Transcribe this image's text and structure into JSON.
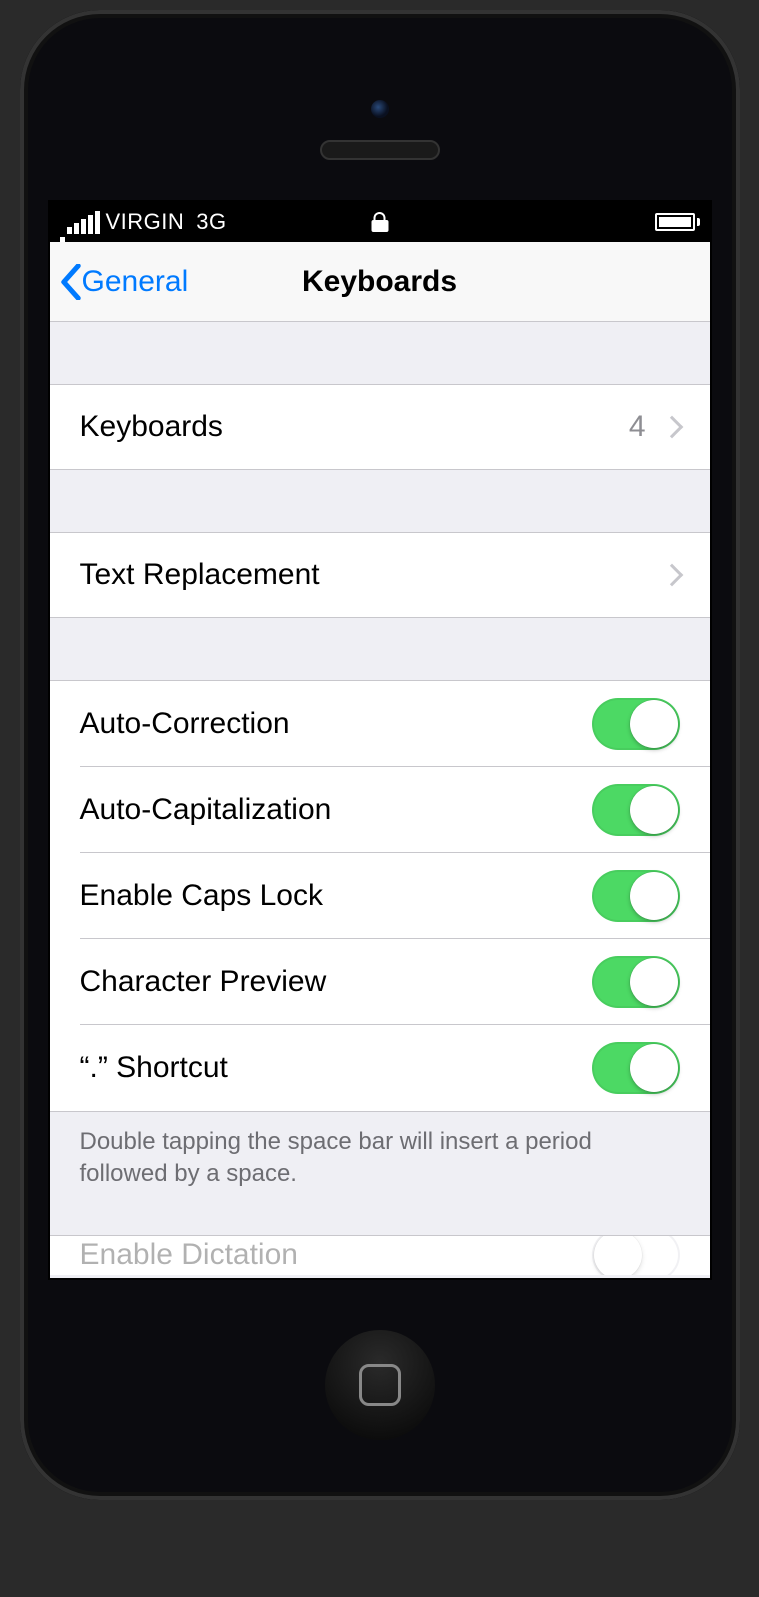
{
  "statusbar": {
    "carrier": "VIRGIN",
    "network": "3G"
  },
  "nav": {
    "back_label": "General",
    "title": "Keyboards"
  },
  "rows": {
    "keyboards": {
      "label": "Keyboards",
      "value": "4"
    },
    "text_replacement": {
      "label": "Text Replacement"
    }
  },
  "toggles": [
    {
      "label": "Auto-Correction",
      "on": true
    },
    {
      "label": "Auto-Capitalization",
      "on": true
    },
    {
      "label": "Enable Caps Lock",
      "on": true
    },
    {
      "label": "Character Preview",
      "on": true
    },
    {
      "label": "“.” Shortcut",
      "on": true
    }
  ],
  "footer": "Double tapping the space bar will insert a period followed by a space.",
  "peek": {
    "label": "Enable Dictation",
    "on": false
  }
}
